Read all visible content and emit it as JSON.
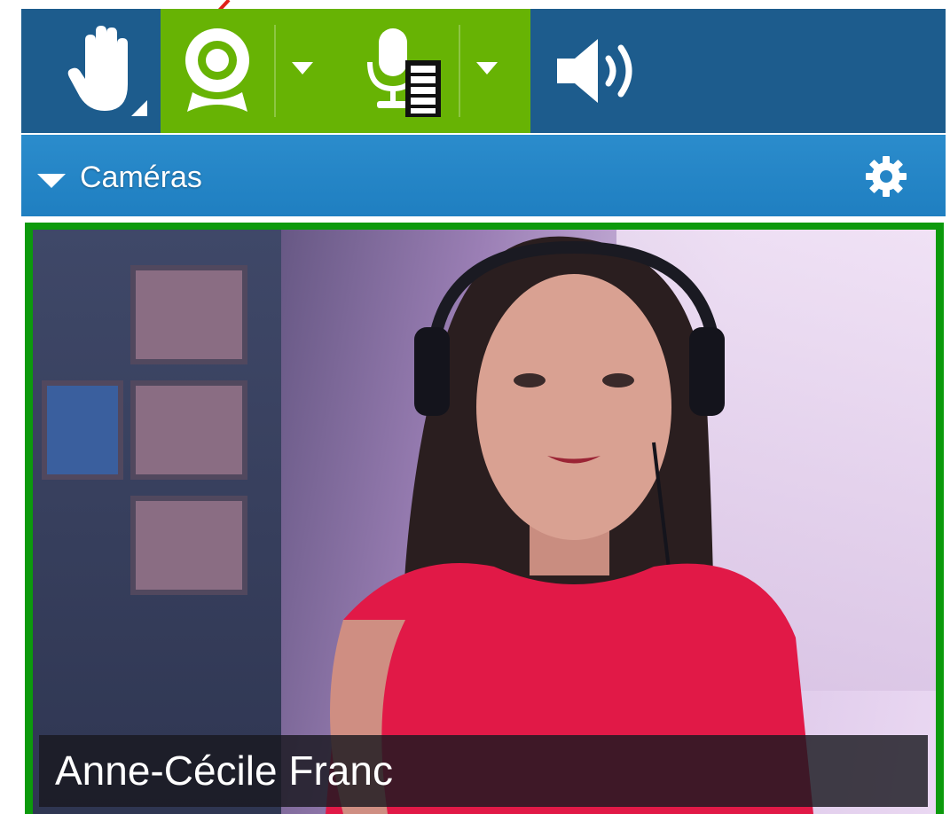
{
  "toolbar": {
    "tools": [
      {
        "name": "raise-hand",
        "icon": "hand-icon",
        "has_menu": true
      },
      {
        "name": "webcam",
        "icon": "webcam-icon",
        "active": true,
        "has_menu": true
      },
      {
        "name": "microphone",
        "icon": "microphone-icon",
        "active": true,
        "has_menu": true
      },
      {
        "name": "speaker",
        "icon": "speaker-icon"
      }
    ],
    "active_color": "#67b304",
    "bar_color": "#1d5c8d"
  },
  "panel": {
    "title": "Caméras",
    "icon_collapse": "triangle-down-icon",
    "icon_settings": "gear-icon",
    "header_color": "#2585c6"
  },
  "video": {
    "participant_name": "Anne-Cécile Franc",
    "frame_color": "#0c9a0c"
  },
  "annotation": {
    "arrow_color": "#e0201a"
  }
}
